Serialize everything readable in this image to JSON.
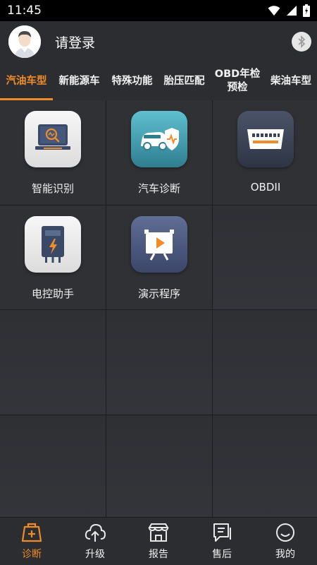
{
  "status_bar": {
    "time": "11:45"
  },
  "header": {
    "login_text": "请登录"
  },
  "tabs": [
    {
      "label": "汽油车型",
      "active": true
    },
    {
      "label": "新能源车",
      "active": false
    },
    {
      "label": "特殊功能",
      "active": false
    },
    {
      "label": "胎压匹配",
      "active": false
    },
    {
      "label": "OBD年检预检",
      "active": false
    },
    {
      "label": "柴油车型",
      "active": false
    }
  ],
  "grid": {
    "items": [
      {
        "label": "智能识别",
        "icon": "smart-identify-icon"
      },
      {
        "label": "汽车诊断",
        "icon": "car-diagnosis-icon"
      },
      {
        "label": "OBDII",
        "icon": "obd-connector-icon"
      },
      {
        "label": "电控助手",
        "icon": "ecu-assistant-icon"
      },
      {
        "label": "演示程序",
        "icon": "demo-play-icon"
      }
    ]
  },
  "bottom_nav": [
    {
      "label": "诊断",
      "icon": "diagnosis-icon",
      "active": true
    },
    {
      "label": "升级",
      "icon": "cloud-upload-icon",
      "active": false
    },
    {
      "label": "报告",
      "icon": "report-icon",
      "active": false
    },
    {
      "label": "售后",
      "icon": "after-sales-icon",
      "active": false
    },
    {
      "label": "我的",
      "icon": "smiley-icon",
      "active": false
    }
  ],
  "colors": {
    "accent": "#f08c28",
    "background": "#25272b",
    "header": "#2b2d31"
  }
}
